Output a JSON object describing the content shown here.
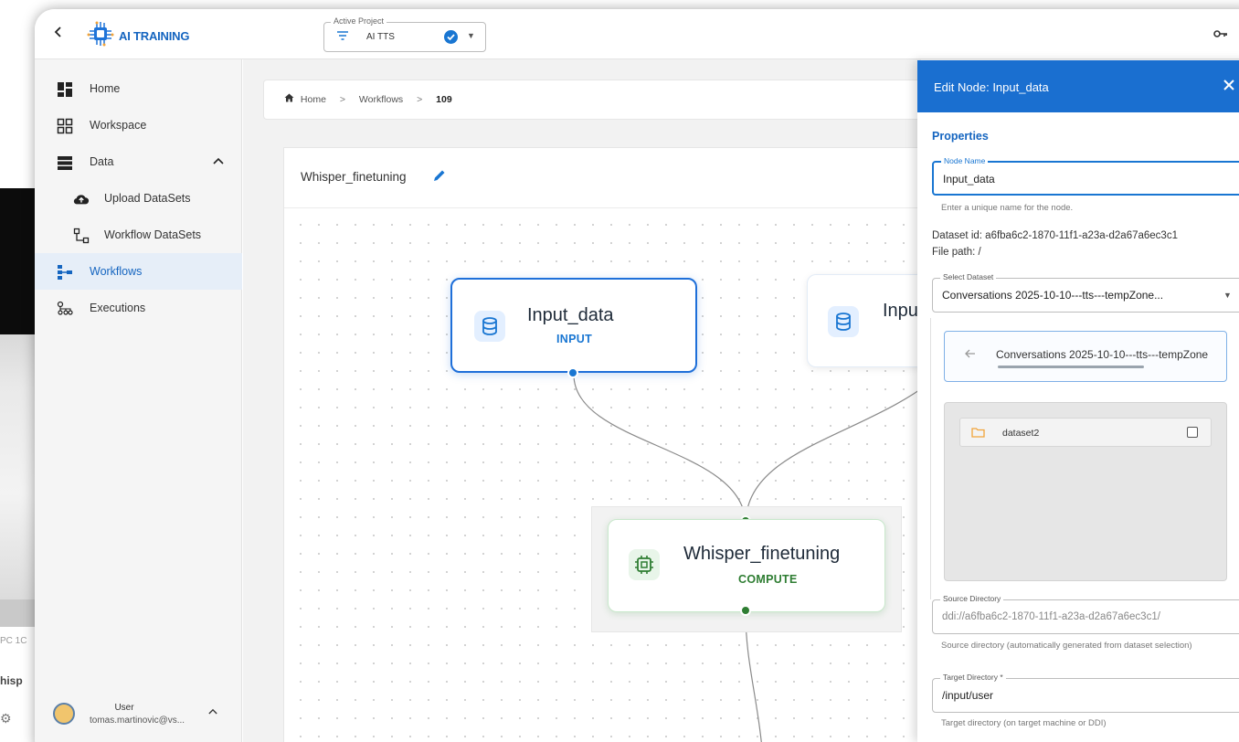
{
  "topbar": {
    "brand": "AI TRAINING",
    "active_project_label": "Active Project",
    "active_project_value": "AI TTS"
  },
  "sidebar": {
    "items": [
      {
        "label": "Home"
      },
      {
        "label": "Workspace"
      },
      {
        "label": "Data"
      },
      {
        "label": "Upload DataSets"
      },
      {
        "label": "Workflow DataSets"
      },
      {
        "label": "Workflows"
      },
      {
        "label": "Executions"
      }
    ],
    "active": "Workflows",
    "user": {
      "name": "User",
      "email": "tomas.martinovic@vs..."
    }
  },
  "breadcrumb": {
    "home": "Home",
    "workflows": "Workflows",
    "current": "109"
  },
  "workflow": {
    "title": "Whisper_finetuning",
    "nodes": [
      {
        "title": "Input_data",
        "type": "INPUT"
      },
      {
        "title": "Inpu",
        "type": ""
      },
      {
        "title": "Whisper_finetuning",
        "type": "COMPUTE"
      }
    ]
  },
  "panel": {
    "title": "Edit Node: Input_data",
    "section": "Properties",
    "node_name_label": "Node Name",
    "node_name_value": "Input_data",
    "node_name_help": "Enter a unique name for the node.",
    "dataset_id": "Dataset id: a6fba6c2-1870-11f1-a23a-d2a67a6ec3c1",
    "file_path": "File path: /",
    "select_dataset_label": "Select Dataset",
    "select_dataset_value": "Conversations 2025-10-10---tts---tempZone...",
    "browser_path": "Conversations 2025-10-10---tts---tempZone",
    "folders": [
      {
        "name": "dataset2"
      }
    ],
    "source_dir_label": "Source Directory",
    "source_dir_value": "ddi://a6fba6c2-1870-11f1-a23a-d2a67a6ec3c1/",
    "source_dir_help": "Source directory (automatically generated from dataset selection)",
    "target_dir_label": "Target Directory *",
    "target_dir_value": "/input/user",
    "target_dir_help": "Target directory (on target machine or DDI)"
  },
  "background_window": {
    "text1": "PC 1C",
    "text2": "hisp"
  },
  "colors": {
    "accent": "#1a6fd0",
    "compute": "#2e7d32",
    "input_border": "#1e6fd9"
  }
}
